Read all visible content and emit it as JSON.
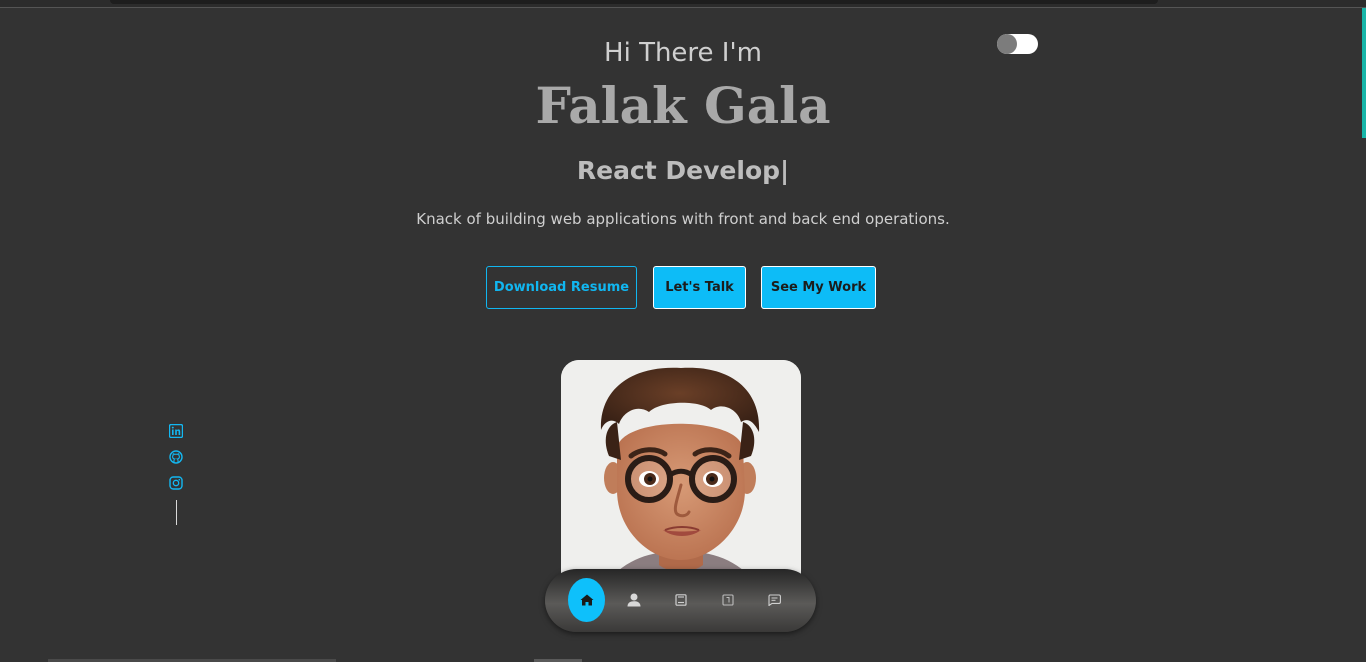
{
  "hero": {
    "greeting": "Hi There I'm",
    "name": "Falak Gala",
    "role": "React Develop|",
    "tagline": "Knack of building web applications with front and back end operations."
  },
  "buttons": {
    "resume": "Download Resume",
    "talk": "Let's Talk",
    "work": "See My Work"
  },
  "theme_toggle": {
    "state": "off"
  },
  "social": [
    {
      "icon": "linkedin-icon"
    },
    {
      "icon": "github-icon"
    },
    {
      "icon": "instagram-icon"
    }
  ],
  "dock": {
    "items": [
      {
        "icon": "home-icon",
        "active": true
      },
      {
        "icon": "user-icon",
        "active": false
      },
      {
        "icon": "book-icon",
        "active": false
      },
      {
        "icon": "project-icon",
        "active": false
      },
      {
        "icon": "message-icon",
        "active": false
      }
    ]
  },
  "colors": {
    "background": "#333333",
    "accent": "#0dbcf7",
    "name_text": "#a9a9a9"
  }
}
